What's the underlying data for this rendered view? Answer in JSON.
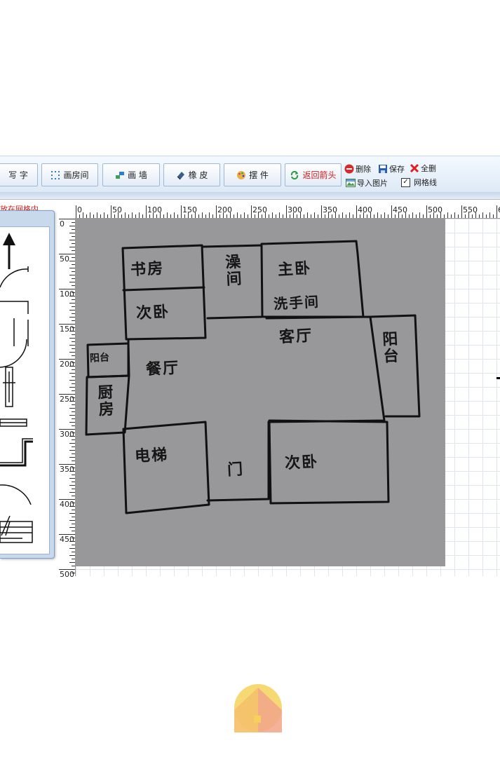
{
  "toolbar": {
    "write_text": "写 字",
    "draw_room": "画房间",
    "draw_wall": "画 墙",
    "eraser": "橡 皮",
    "place_item": "摆 件",
    "back_arrow": "返回箭头",
    "delete": "删除",
    "save": "保存",
    "clear_all": "全删",
    "import_image": "导入图片",
    "grid_lines": "网格线",
    "grid_checked": true
  },
  "hint_text": "放在网格内",
  "ruler": {
    "top": [
      "0",
      "50",
      "100",
      "150",
      "200",
      "250",
      "300",
      "350",
      "400",
      "450",
      "500",
      "550",
      "6"
    ],
    "left": [
      "0",
      "50",
      "100",
      "150",
      "200",
      "250",
      "300",
      "350",
      "400",
      "450",
      "500"
    ]
  },
  "rooms": {
    "study": "书房",
    "bathroom": "澡间",
    "master_bedroom": "主卧",
    "washroom": "洗手间",
    "second_bedroom_top": "次卧",
    "living_room": "客厅",
    "balcony_right": "阳台",
    "balcony_left": "阳台",
    "dining_room": "餐厅",
    "kitchen": "厨房",
    "elevator": "电梯",
    "door": "门",
    "second_bedroom_bottom": "次卧"
  },
  "colors": {
    "accent_red": "#d02020",
    "toolbar_bg": "#e3ecf7",
    "photo_paper": "#98989a"
  }
}
